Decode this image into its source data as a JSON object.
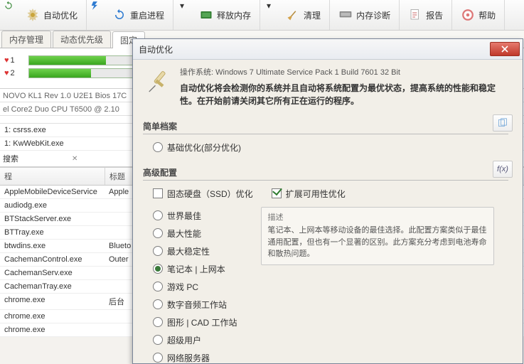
{
  "toolbar": [
    {
      "label": "自动优化",
      "icon": "gear"
    },
    {
      "label": "重启进程",
      "icon": "refresh"
    },
    {
      "label": "释放内存",
      "icon": "chip-green"
    },
    {
      "label": "清理",
      "icon": "broom"
    },
    {
      "label": "内存诊断",
      "icon": "chip"
    },
    {
      "label": "报告",
      "icon": "report"
    },
    {
      "label": "帮助",
      "icon": "help"
    }
  ],
  "tabs": [
    {
      "label": "内存管理",
      "active": false
    },
    {
      "label": "动态优先级",
      "active": false
    },
    {
      "label": "固定",
      "active": true
    }
  ],
  "hearts": [
    {
      "label": "心 1",
      "pct": 72
    },
    {
      "label": "心 2",
      "pct": 58
    }
  ],
  "sysinfo": [
    "NOVO KL1 Rev 1.0 U2E1 Bios 17C",
    "el Core2 Duo CPU T6500 @ 2.10"
  ],
  "midlist": [
    "1: csrss.exe",
    "1: KwWebKit.exe"
  ],
  "search_label": "搜索",
  "ptable": {
    "headers": [
      "程",
      "标题"
    ],
    "rows": [
      [
        "AppleMobileDeviceService",
        "Apple"
      ],
      [
        "audiodg.exe",
        ""
      ],
      [
        "BTStackServer.exe",
        ""
      ],
      [
        "BTTray.exe",
        ""
      ],
      [
        "btwdins.exe",
        "Blueto"
      ],
      [
        "CachemanControl.exe",
        "Outer"
      ],
      [
        "CachemanServ.exe",
        ""
      ],
      [
        "CachemanTray.exe",
        ""
      ],
      [
        "chrome.exe",
        "后台"
      ],
      [
        "chrome.exe",
        ""
      ],
      [
        "chrome.exe",
        ""
      ]
    ]
  },
  "dialog": {
    "title": "自动优化",
    "os_label": "操作系统:",
    "os_value": "Windows 7 Ultimate Service Pack 1 Build 7601 32 Bit",
    "description": "自动优化将会检测你的系统并且自动将系统配置为最优状态，提高系统的性能和稳定性。在开始前请关闭其它所有正在运行的程序。",
    "simple": {
      "title": "简单档案",
      "option": "基础优化(部分优化)"
    },
    "advanced": {
      "title": "高级配置",
      "ssd": "固态硬盘（SSD）优化",
      "ext": "扩展可用性优化",
      "profiles": [
        "世界最佳",
        "最大性能",
        "最大稳定性",
        "笔记本 | 上网本",
        "游戏 PC",
        "数字音频工作站",
        "图形 | CAD 工作站",
        "超级用户",
        "网络服务器"
      ],
      "selected_index": 3,
      "desc_title": "描述",
      "desc_body": "笔记本、上网本等移动设备的最佳选择。此配置方案类似于最佳通用配置，但也有一个显著的区别。此方案充分考虑到电池寿命和散热问题。"
    }
  }
}
